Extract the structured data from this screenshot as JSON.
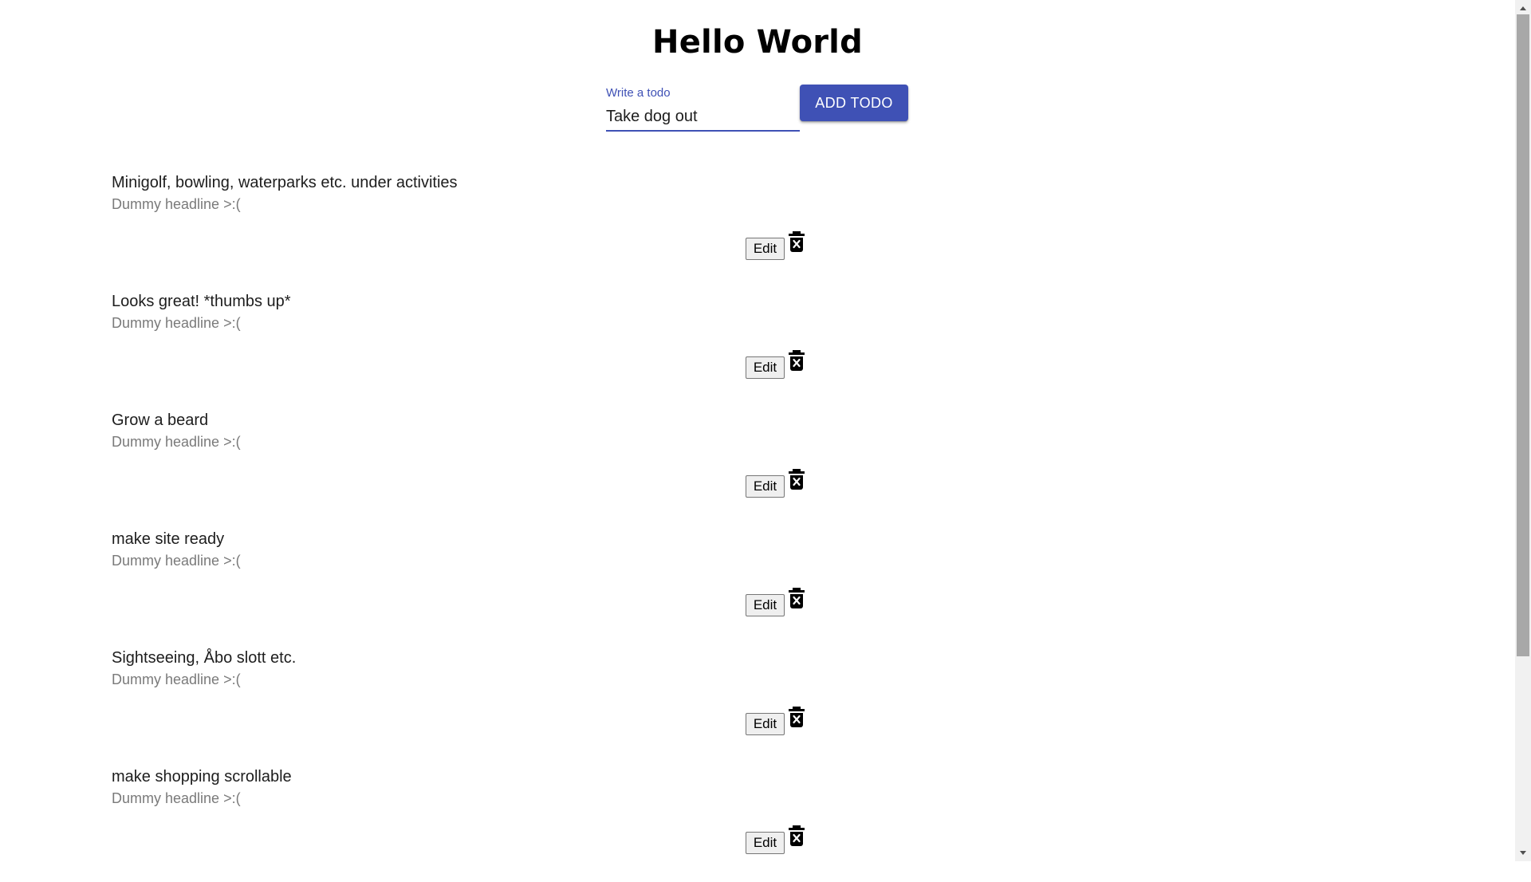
{
  "page": {
    "title": "Hello World"
  },
  "form": {
    "label": "Write a todo",
    "value": "Take dog out",
    "add_button_label": "ADD TODO",
    "accent_color": "#3f51b5"
  },
  "todos": [
    {
      "title": "Minigolf, bowling, waterparks etc. under activities",
      "subtitle": "Dummy headline >:(",
      "edit_label": "Edit"
    },
    {
      "title": "Looks great! *thumbs up*",
      "subtitle": "Dummy headline >:(",
      "edit_label": "Edit"
    },
    {
      "title": "Grow a beard",
      "subtitle": "Dummy headline >:(",
      "edit_label": "Edit"
    },
    {
      "title": "make site ready",
      "subtitle": "Dummy headline >:(",
      "edit_label": "Edit"
    },
    {
      "title": "Sightseeing, Åbo slott etc.",
      "subtitle": "Dummy headline >:(",
      "edit_label": "Edit"
    },
    {
      "title": "make shopping scrollable",
      "subtitle": "Dummy headline >:(",
      "edit_label": "Edit"
    }
  ],
  "icons": {
    "delete": "delete-forever-icon"
  }
}
